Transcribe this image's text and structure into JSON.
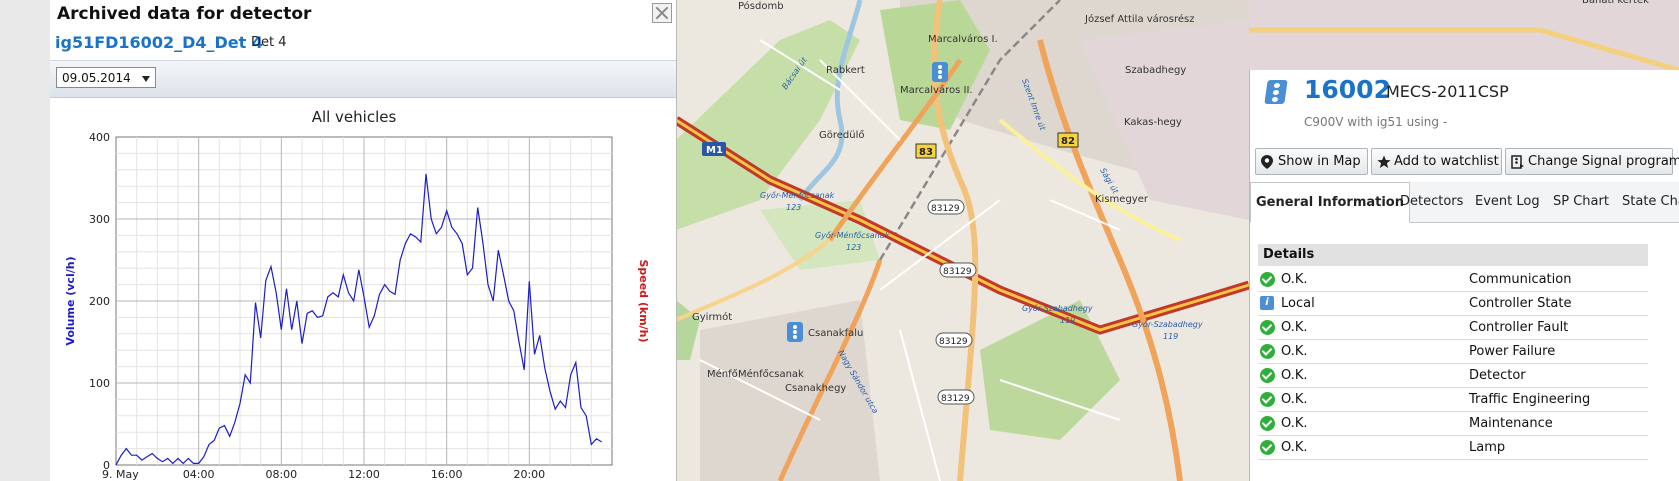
{
  "dialog": {
    "title": "Archived data for detector",
    "detector_id": "ig51FD16002_D4_Det 4",
    "detector_label": "Det 4",
    "date_value": "09.05.2014"
  },
  "chart_data": {
    "type": "line",
    "title": "All vehicles",
    "ylabel": "Volume (vcl/h)",
    "ylabel_right": "Speed (km/h)",
    "ylim": [
      0,
      400
    ],
    "yticks": [
      "0",
      "100",
      "200",
      "300",
      "400"
    ],
    "xlim_hours": [
      0,
      24
    ],
    "xticks": [
      {
        "h": 0,
        "label": "9. May"
      },
      {
        "h": 4,
        "label": "04:00"
      },
      {
        "h": 8,
        "label": "08:00"
      },
      {
        "h": 12,
        "label": "12:00"
      },
      {
        "h": 16,
        "label": "16:00"
      },
      {
        "h": 20,
        "label": "20:00"
      }
    ],
    "series": [
      {
        "name": "Volume",
        "color": "#1c1ccc",
        "points": [
          [
            0,
            0
          ],
          [
            0.25,
            12
          ],
          [
            0.5,
            20
          ],
          [
            0.75,
            12
          ],
          [
            1,
            12
          ],
          [
            1.25,
            6
          ],
          [
            1.5,
            10
          ],
          [
            1.75,
            14
          ],
          [
            2,
            8
          ],
          [
            2.25,
            4
          ],
          [
            2.5,
            8
          ],
          [
            2.75,
            2
          ],
          [
            3,
            8
          ],
          [
            3.25,
            2
          ],
          [
            3.5,
            8
          ],
          [
            3.75,
            2
          ],
          [
            4,
            2
          ],
          [
            4.25,
            10
          ],
          [
            4.5,
            25
          ],
          [
            4.75,
            30
          ],
          [
            5,
            45
          ],
          [
            5.25,
            48
          ],
          [
            5.5,
            35
          ],
          [
            5.75,
            52
          ],
          [
            6,
            75
          ],
          [
            6.25,
            110
          ],
          [
            6.5,
            100
          ],
          [
            6.75,
            198
          ],
          [
            7,
            155
          ],
          [
            7.25,
            225
          ],
          [
            7.5,
            242
          ],
          [
            7.75,
            210
          ],
          [
            8,
            165
          ],
          [
            8.25,
            215
          ],
          [
            8.5,
            165
          ],
          [
            8.75,
            200
          ],
          [
            9,
            148
          ],
          [
            9.25,
            185
          ],
          [
            9.5,
            188
          ],
          [
            9.75,
            180
          ],
          [
            10,
            182
          ],
          [
            10.25,
            205
          ],
          [
            10.5,
            210
          ],
          [
            10.75,
            205
          ],
          [
            11,
            232
          ],
          [
            11.25,
            210
          ],
          [
            11.5,
            200
          ],
          [
            11.75,
            238
          ],
          [
            12,
            205
          ],
          [
            12.25,
            168
          ],
          [
            12.5,
            182
          ],
          [
            12.75,
            208
          ],
          [
            13,
            220
          ],
          [
            13.25,
            212
          ],
          [
            13.5,
            208
          ],
          [
            13.75,
            250
          ],
          [
            14,
            270
          ],
          [
            14.25,
            282
          ],
          [
            14.5,
            278
          ],
          [
            14.75,
            272
          ],
          [
            15,
            355
          ],
          [
            15.25,
            300
          ],
          [
            15.5,
            282
          ],
          [
            15.75,
            290
          ],
          [
            16,
            310
          ],
          [
            16.25,
            290
          ],
          [
            16.5,
            282
          ],
          [
            16.75,
            270
          ],
          [
            17,
            232
          ],
          [
            17.25,
            240
          ],
          [
            17.5,
            314
          ],
          [
            17.75,
            272
          ],
          [
            18,
            220
          ],
          [
            18.25,
            200
          ],
          [
            18.5,
            262
          ],
          [
            18.75,
            232
          ],
          [
            19,
            200
          ],
          [
            19.25,
            188
          ],
          [
            19.5,
            150
          ],
          [
            19.75,
            116
          ],
          [
            20,
            224
          ],
          [
            20.25,
            135
          ],
          [
            20.5,
            158
          ],
          [
            20.75,
            118
          ],
          [
            21,
            90
          ],
          [
            21.25,
            68
          ],
          [
            21.5,
            78
          ],
          [
            21.75,
            70
          ],
          [
            22,
            110
          ],
          [
            22.25,
            125
          ],
          [
            22.5,
            70
          ],
          [
            22.75,
            60
          ],
          [
            23,
            25
          ],
          [
            23.25,
            32
          ],
          [
            23.5,
            28
          ]
        ]
      }
    ]
  },
  "map": {
    "labels": [
      "Pósdomb",
      "József Attila városrész",
      "Marcalváros I.",
      "Marcalváros II.",
      "Rabkert",
      "Szabadhegy",
      "Kakas-hegy",
      "Göredülő",
      "Kismegyer",
      "Gyirmót",
      "Csanakfalu",
      "Ménfő",
      "Ménfőcsanak",
      "Csanakhegy",
      "Bácsai út (road)",
      "Szent Imre út",
      "Sági út",
      "Nagy Sándor utca",
      "Bánáti kertek"
    ],
    "road_refs": [
      "M1",
      "83",
      "82",
      "83129",
      "83129",
      "83129",
      "83129"
    ],
    "junction_labels": [
      "Győr-Ménfőcsanak 123",
      "Győr-Ménfőcsanak 123",
      "Győr-Szabadhegy 119",
      "Győr-Szabadhegy 119"
    ]
  },
  "controller": {
    "id": "16002",
    "name": "MECS-2011CSP",
    "description": "C900V with ig51 using -",
    "buttons": {
      "show_in_map": "Show in Map",
      "add_to_watchlist": "Add to watchlist",
      "change_signal_program": "Change Signal program"
    },
    "tabs": [
      "General Information",
      "Detectors",
      "Event Log",
      "SP Chart",
      "State Chart"
    ],
    "details_heading": "Details",
    "details": [
      {
        "status": "O.K.",
        "icon": "ok-icon",
        "name": "Communication"
      },
      {
        "status": "Local",
        "icon": "info-icon",
        "name": "Controller State"
      },
      {
        "status": "O.K.",
        "icon": "ok-icon",
        "name": "Controller Fault"
      },
      {
        "status": "O.K.",
        "icon": "ok-icon",
        "name": "Power Failure"
      },
      {
        "status": "O.K.",
        "icon": "ok-icon",
        "name": "Detector"
      },
      {
        "status": "O.K.",
        "icon": "ok-icon",
        "name": "Traffic Engineering"
      },
      {
        "status": "O.K.",
        "icon": "ok-icon",
        "name": "Maintenance"
      },
      {
        "status": "O.K.",
        "icon": "ok-icon",
        "name": "Lamp"
      }
    ]
  }
}
